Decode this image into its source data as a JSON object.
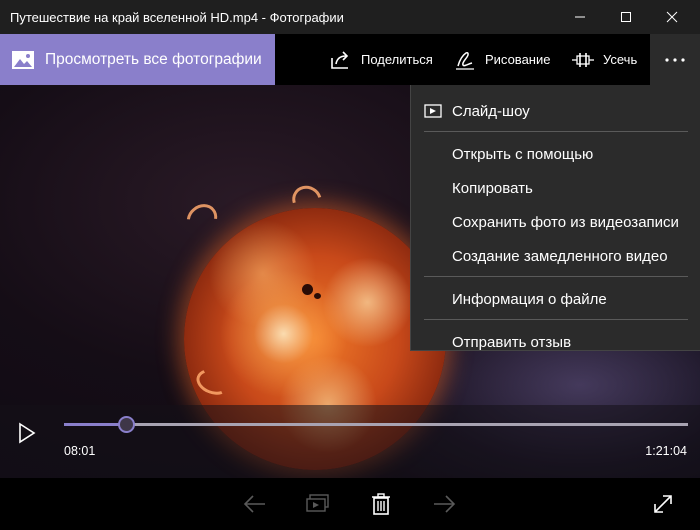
{
  "window": {
    "title": "Путешествие на край вселенной HD.mp4 - Фотографии",
    "minimize_icon": "minimize-icon",
    "maximize_icon": "maximize-icon",
    "close_icon": "close-icon"
  },
  "toolbar": {
    "view_all_label": "Просмотреть все фотографии",
    "share_label": "Поделиться",
    "draw_label": "Рисование",
    "trim_label": "Усечь",
    "accent_color": "#8a7fcb"
  },
  "menu": {
    "items": [
      {
        "label": "Слайд-шоу",
        "icon": "slideshow-icon"
      },
      {
        "label": "Открыть с помощью"
      },
      {
        "label": "Копировать"
      },
      {
        "label": "Сохранить фото из видеозаписи"
      },
      {
        "label": "Создание замедленного видео"
      },
      {
        "label": "Информация о файле"
      },
      {
        "label": "Отправить отзыв"
      }
    ]
  },
  "player": {
    "current_time": "08:01",
    "total_time": "1:21:04",
    "progress_fraction": 0.099
  },
  "bottom_bar": {
    "icons": [
      "back-arrow-icon",
      "slideshow-icon",
      "delete-icon",
      "forward-arrow-icon",
      "fullscreen-icon"
    ]
  }
}
